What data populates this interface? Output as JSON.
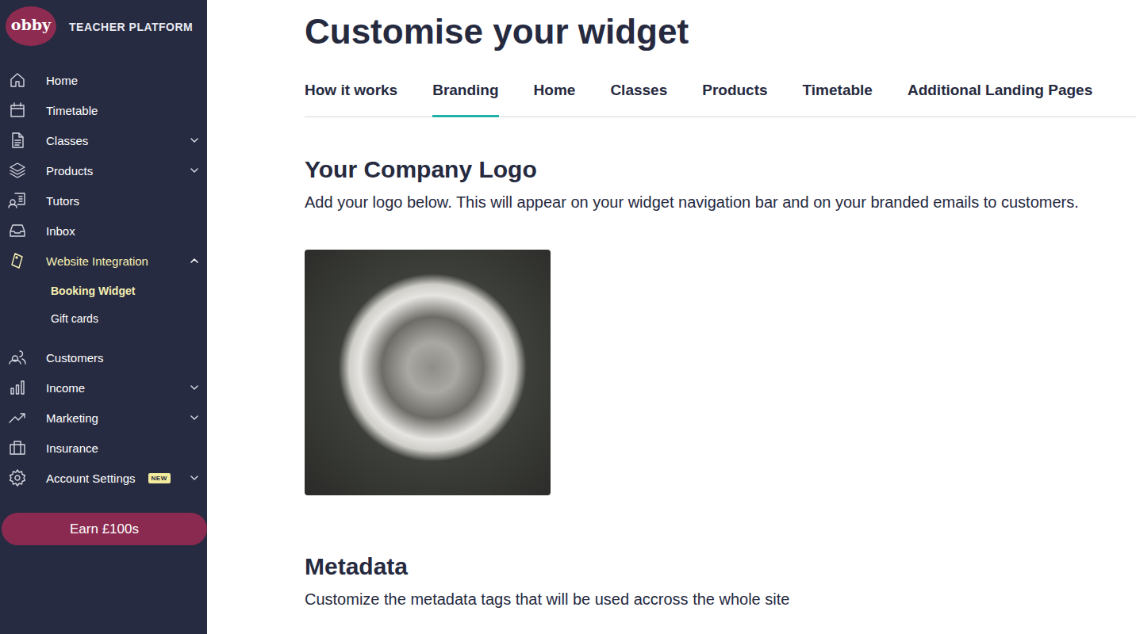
{
  "sidebar": {
    "logo": "obby",
    "subtitle": "TEACHER PLATFORM",
    "items": [
      {
        "label": "Home",
        "selected": false,
        "expandable": false,
        "expanded": false,
        "children": []
      },
      {
        "label": "Timetable",
        "selected": false,
        "expandable": false,
        "expanded": false,
        "children": []
      },
      {
        "label": "Classes",
        "selected": false,
        "expandable": true,
        "expanded": false,
        "children": []
      },
      {
        "label": "Products",
        "selected": false,
        "expandable": true,
        "expanded": false,
        "children": []
      },
      {
        "label": "Tutors",
        "selected": false,
        "expandable": false,
        "expanded": false,
        "children": []
      },
      {
        "label": "Inbox",
        "selected": false,
        "expandable": false,
        "expanded": false,
        "children": []
      },
      {
        "label": "Website Integration",
        "selected": true,
        "expandable": true,
        "expanded": true,
        "children": [
          {
            "label": "Booking Widget",
            "selected": true
          },
          {
            "label": "Gift cards",
            "selected": false
          }
        ]
      },
      {
        "label": "Customers",
        "selected": false,
        "expandable": false,
        "expanded": false,
        "children": []
      },
      {
        "label": "Income",
        "selected": false,
        "expandable": true,
        "expanded": false,
        "children": []
      },
      {
        "label": "Marketing",
        "selected": false,
        "expandable": true,
        "expanded": false,
        "children": []
      },
      {
        "label": "Insurance",
        "selected": false,
        "expandable": false,
        "expanded": false,
        "children": []
      },
      {
        "label": "Account Settings",
        "selected": false,
        "expandable": true,
        "expanded": false,
        "badge": "NEW",
        "children": []
      }
    ],
    "cta": "Earn £100s"
  },
  "page": {
    "title": "Customise your widget",
    "tabs": [
      {
        "label": "How it works",
        "selected": false
      },
      {
        "label": "Branding",
        "selected": true
      },
      {
        "label": "Home",
        "selected": false
      },
      {
        "label": "Classes",
        "selected": false
      },
      {
        "label": "Products",
        "selected": false
      },
      {
        "label": "Timetable",
        "selected": false
      },
      {
        "label": "Additional Landing Pages",
        "selected": false
      }
    ],
    "sections": [
      {
        "kind": "logo",
        "heading": "Your Company Logo",
        "description": "Add your logo below. This will appear on your widget navigation bar and on your branded emails to customers."
      },
      {
        "kind": "text",
        "heading": "Metadata",
        "description": "Customize the metadata tags that will be used accross the whole site"
      }
    ]
  }
}
